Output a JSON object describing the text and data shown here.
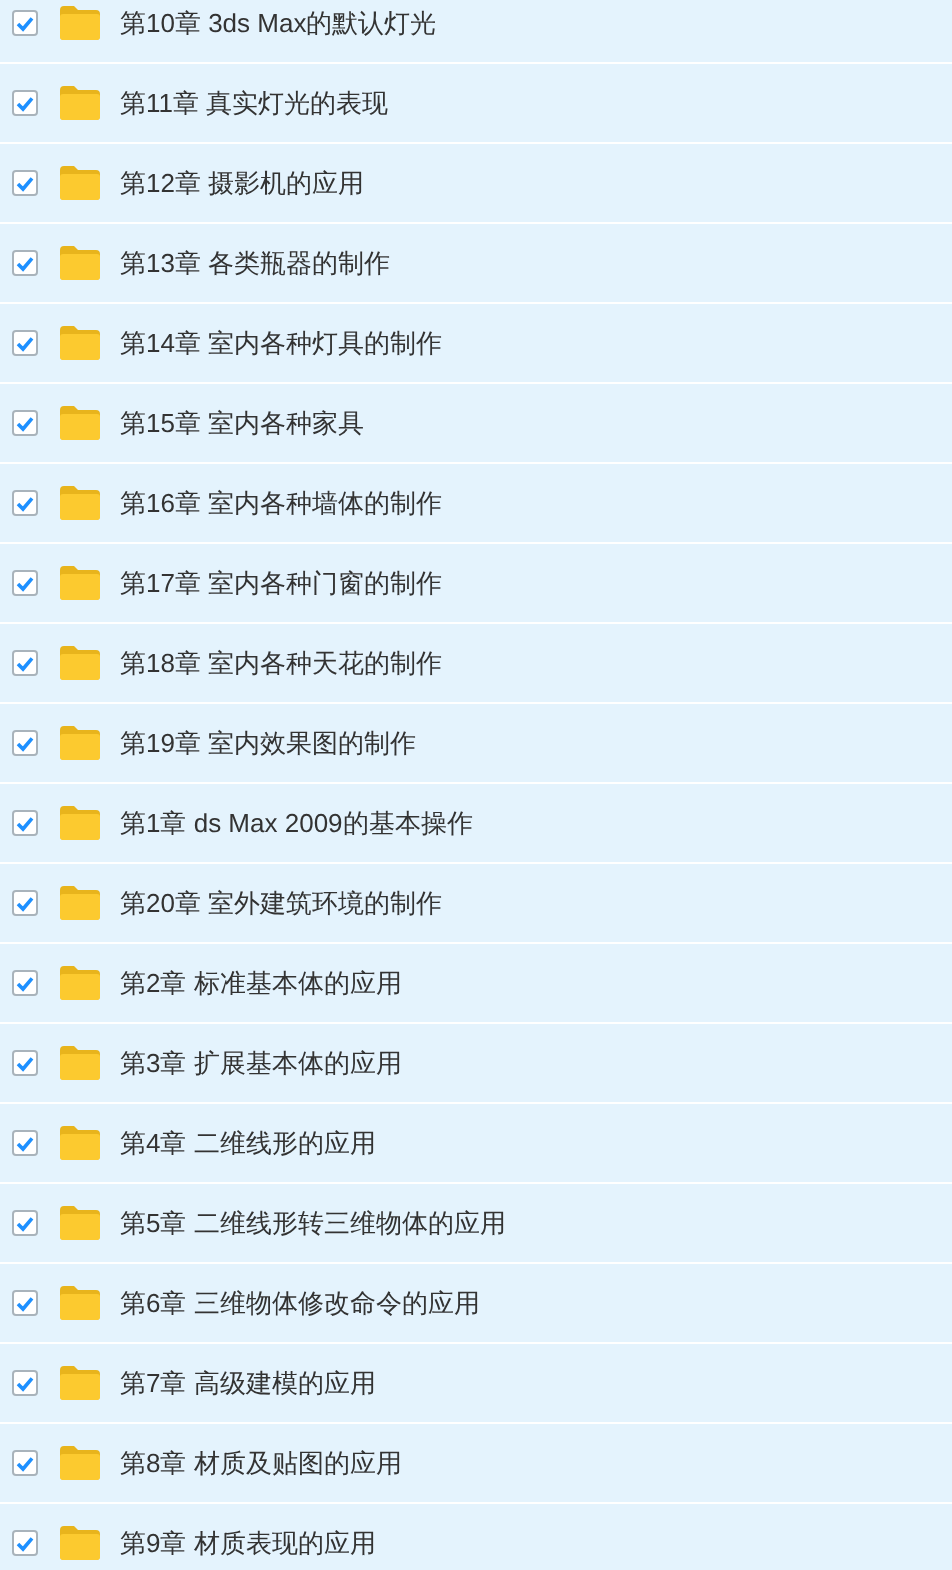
{
  "items": [
    {
      "label": "第10章 3ds Max的默认灯光",
      "checked": true
    },
    {
      "label": "第11章 真实灯光的表现",
      "checked": true
    },
    {
      "label": "第12章 摄影机的应用",
      "checked": true
    },
    {
      "label": "第13章 各类瓶器的制作",
      "checked": true
    },
    {
      "label": "第14章 室内各种灯具的制作",
      "checked": true
    },
    {
      "label": "第15章 室内各种家具",
      "checked": true
    },
    {
      "label": "第16章 室内各种墙体的制作",
      "checked": true
    },
    {
      "label": "第17章 室内各种门窗的制作",
      "checked": true
    },
    {
      "label": "第18章 室内各种天花的制作",
      "checked": true
    },
    {
      "label": "第19章 室内效果图的制作",
      "checked": true
    },
    {
      "label": "第1章 ds Max 2009的基本操作",
      "checked": true
    },
    {
      "label": "第20章 室外建筑环境的制作",
      "checked": true
    },
    {
      "label": "第2章 标准基本体的应用",
      "checked": true
    },
    {
      "label": "第3章 扩展基本体的应用",
      "checked": true
    },
    {
      "label": "第4章 二维线形的应用",
      "checked": true
    },
    {
      "label": "第5章 二维线形转三维物体的应用",
      "checked": true
    },
    {
      "label": "第6章 三维物体修改命令的应用",
      "checked": true
    },
    {
      "label": "第7章 高级建模的应用",
      "checked": true
    },
    {
      "label": "第8章 材质及贴图的应用",
      "checked": true
    },
    {
      "label": "第9章 材质表现的应用",
      "checked": true
    }
  ]
}
